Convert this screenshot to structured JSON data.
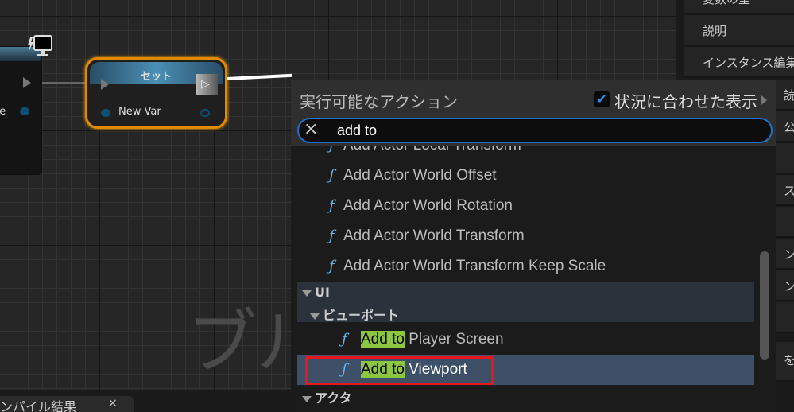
{
  "graph": {
    "left_node_pin_label": "ue",
    "set_node": {
      "title": "セット",
      "pin_label": "New Var"
    },
    "watermark": "ブルー",
    "bottom_tab": {
      "label": "ンパイル結果",
      "close": "×"
    }
  },
  "details_panel": {
    "rows": [
      "変数の型",
      "説明",
      "インスタンス編集",
      "読",
      "公開",
      "",
      "スに",
      "",
      "ン",
      "ン",
      "",
      "をす"
    ]
  },
  "action_menu": {
    "title": "実行可能なアクション",
    "context_sensitive_label": "状況に合わせた表示",
    "context_sensitive_checked": true,
    "search_value": "add to",
    "clear_icon": "×",
    "items_top": [
      "Add Actor Local Transform",
      "Add Actor World Offset",
      "Add Actor World Rotation",
      "Add Actor World Transform",
      "Add Actor World Transform Keep Scale"
    ],
    "category_ui": "UI",
    "subcategory_viewport": "ビューポート",
    "match_text": "Add to",
    "viewport_items": [
      " Player Screen",
      " Viewport"
    ],
    "category_actor": "アクタ",
    "function_glyph": "ƒ",
    "selected_item": "Add to Viewport"
  },
  "colors": {
    "highlight": "#8dc63f",
    "selection": "#3e5068",
    "annotation_box": "#e8151f",
    "node_border": "#e08a00",
    "search_border": "#1d6fc7"
  }
}
